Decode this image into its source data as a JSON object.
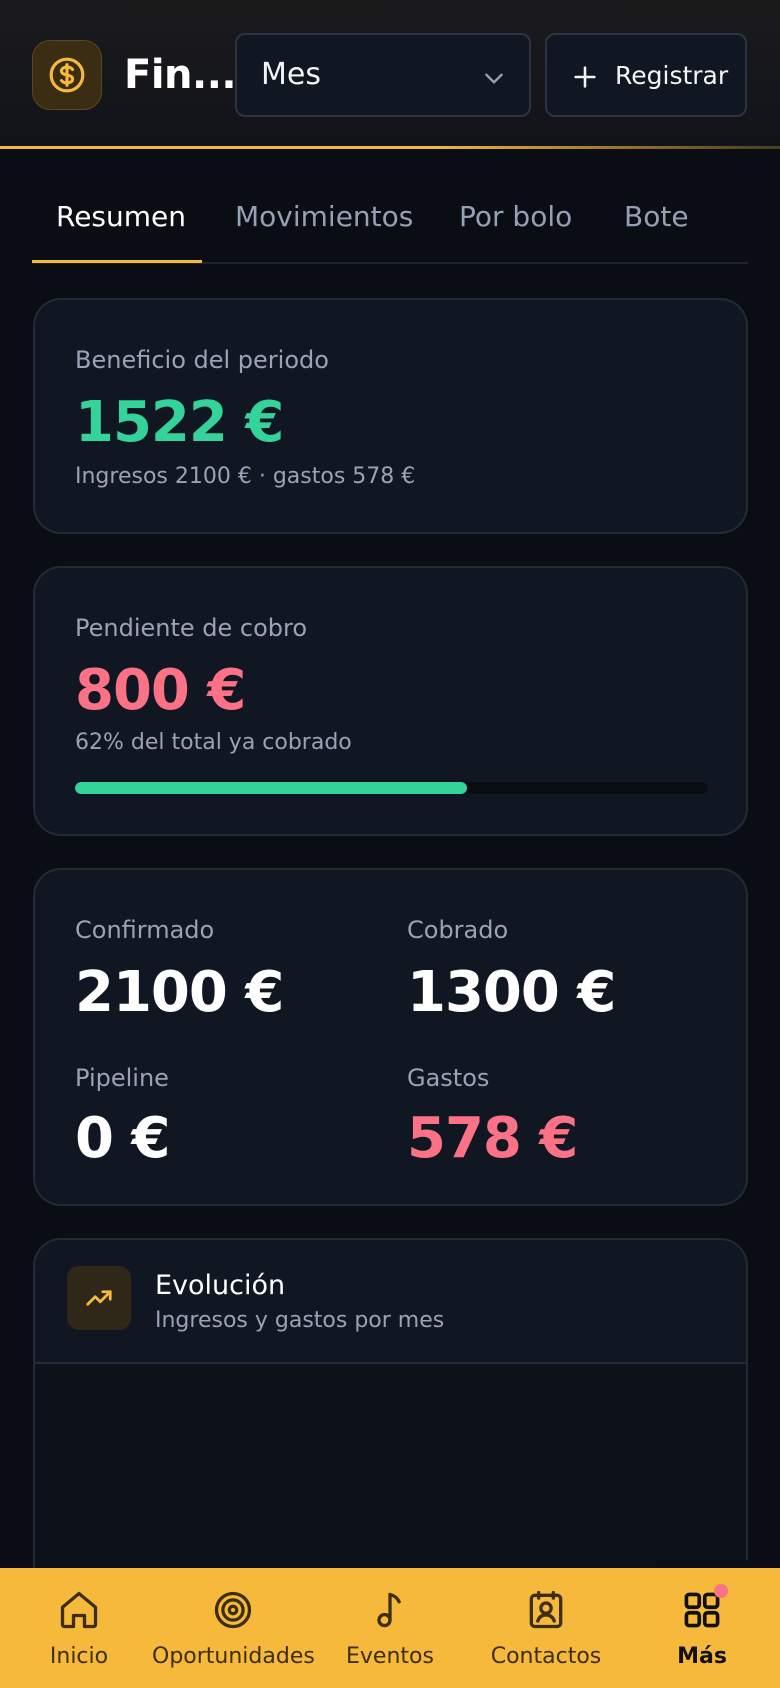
{
  "header": {
    "title": "Fin...",
    "logo_icon": "dollar-circle-icon",
    "period": {
      "value": "Mes"
    },
    "register_label": "Registrar"
  },
  "tabs": [
    {
      "label": "Resumen",
      "active": true
    },
    {
      "label": "Movimientos",
      "active": false
    },
    {
      "label": "Por bolo",
      "active": false
    },
    {
      "label": "Bote",
      "active": false
    }
  ],
  "profit": {
    "label": "Beneficio del periodo",
    "value": "1522 €",
    "detail": "Ingresos 2100 € · gastos 578 €"
  },
  "pending": {
    "label": "Pendiente de cobro",
    "value": "800 €",
    "detail": "62% del total ya cobrado",
    "progress_percent": 62
  },
  "stats": {
    "confirmed": {
      "label": "Confirmado",
      "value": "2100 €"
    },
    "collected": {
      "label": "Cobrado",
      "value": "1300 €"
    },
    "pipeline": {
      "label": "Pipeline",
      "value": "0 €"
    },
    "expenses": {
      "label": "Gastos",
      "value": "578 €"
    }
  },
  "evolution": {
    "icon": "trending-up-icon",
    "title": "Evolución",
    "subtitle": "Ingresos y gastos por mes"
  },
  "nav": [
    {
      "label": "Inicio",
      "icon": "home-icon"
    },
    {
      "label": "Oportunidades",
      "icon": "target-icon"
    },
    {
      "label": "Eventos",
      "icon": "music-note-icon"
    },
    {
      "label": "Contactos",
      "icon": "contact-card-icon"
    },
    {
      "label": "Más",
      "icon": "grid-icon",
      "active": true
    }
  ],
  "colors": {
    "accent": "#f6b93b",
    "positive": "#34d399",
    "negative": "#fb7185",
    "background": "#0a0d14",
    "card": "#111722"
  }
}
